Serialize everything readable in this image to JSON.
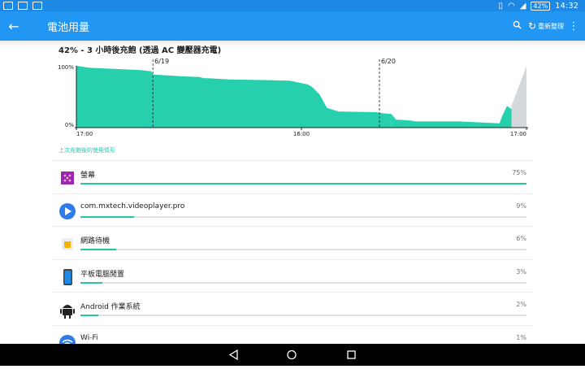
{
  "status_bar": {
    "battery": "42%",
    "time": "14:32"
  },
  "toolbar": {
    "title": "電池用量",
    "refresh_label": "重新整理"
  },
  "summary": "42% - 3 小時後充飽 (透過 AC 變壓器充電)",
  "chart_data": {
    "type": "area",
    "y_tick_labels": [
      "100%",
      "0%"
    ],
    "x_tick_labels": [
      "17:00",
      "16:00",
      "17:00"
    ],
    "day_markers": [
      "6/19",
      "6/20"
    ],
    "ylim": [
      0,
      100
    ],
    "x_unit": "hours elapsed from first 17:00 tick",
    "series": [
      {
        "x": [
          0,
          0.8,
          2.5,
          4.3,
          5.0,
          5.1,
          7.0,
          8.2,
          8.5,
          8.8,
          10.2,
          12.5,
          14.2,
          15.4,
          15.7,
          16.2,
          16.7,
          17.5,
          20.0,
          20.2,
          20.5,
          21.0
        ],
        "y": [
          100,
          97,
          95,
          93,
          91,
          86,
          83,
          82,
          80,
          80,
          78,
          77,
          76,
          70,
          66,
          54,
          32,
          26,
          25,
          24,
          23,
          22
        ]
      }
    ],
    "series2": [
      {
        "x": [
          21.0,
          21.3,
          22.0,
          22.4,
          22.6,
          25.5,
          28.2,
          28.4,
          28.7,
          29.0
        ],
        "y": [
          22,
          13,
          12,
          11,
          10,
          10,
          7,
          20,
          35,
          30
        ]
      }
    ],
    "prediction": {
      "x": [
        29.0,
        30.0
      ],
      "y": [
        35,
        100
      ]
    },
    "colors": {
      "fill": "#26d0ad",
      "prediction_fill": "#d3d8db",
      "axis": "#212121"
    }
  },
  "section_title": "上次充飽後的使用情形",
  "usage_items": [
    {
      "name": "螢幕",
      "percent": "75%",
      "fraction": 1.0,
      "icon": "screen-brightness-icon",
      "icon_color": "#9c27b0"
    },
    {
      "name": "com.mxtech.videoplayer.pro",
      "percent": "9%",
      "fraction": 0.12,
      "icon": "play-icon",
      "icon_color": "#2f7be9"
    },
    {
      "name": "網路待機",
      "percent": "6%",
      "fraction": 0.08,
      "icon": "sim-card-icon",
      "icon_color": "#f5b400"
    },
    {
      "name": "平板電腦閒置",
      "percent": "3%",
      "fraction": 0.05,
      "icon": "tablet-icon",
      "icon_color": "#1e88e5"
    },
    {
      "name": "Android 作業系統",
      "percent": "2%",
      "fraction": 0.04,
      "icon": "android-icon",
      "icon_color": "#222222"
    },
    {
      "name": "Wi-Fi",
      "percent": "1%",
      "fraction": 0.02,
      "icon": "wifi-icon",
      "icon_color": "#2f7be9"
    }
  ]
}
